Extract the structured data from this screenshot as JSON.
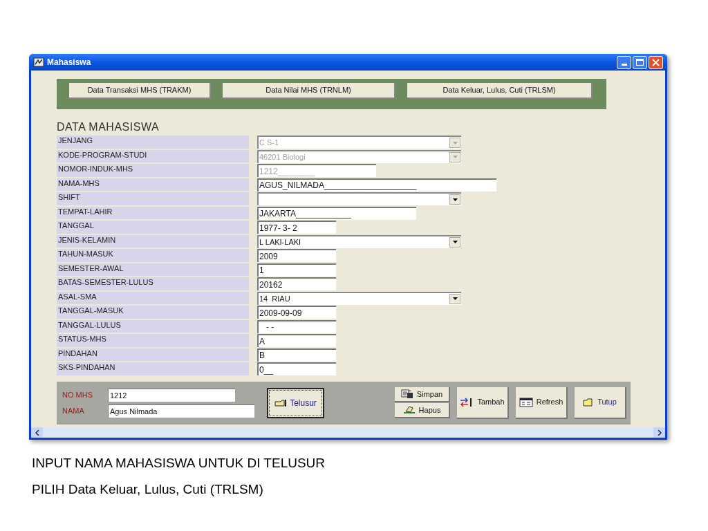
{
  "window": {
    "title": "Mahasiswa"
  },
  "nav_buttons": [
    "Data Transaksi MHS (TRAKM)",
    "Data Nilai MHS (TRNLM)",
    "Data Keluar, Lulus, Cuti (TRLSM)"
  ],
  "section_title": "DATA MAHASISWA",
  "fields": [
    {
      "label": "JENJANG",
      "kind": "combo",
      "value": "C S-1",
      "disabled": true
    },
    {
      "label": "KODE-PROGRAM-STUDI",
      "kind": "combo",
      "value": "46201 Biologi",
      "disabled": true
    },
    {
      "label": "NOMOR-INDUK-MHS",
      "kind": "text",
      "value": "1212________",
      "disabled": true
    },
    {
      "label": "NAMA-MHS",
      "kind": "text",
      "value": "AGUS_NILMADA____________________",
      "disabled": false
    },
    {
      "label": "SHIFT",
      "kind": "combo",
      "disabled": false
    },
    {
      "label": "TEMPAT-LAHIR",
      "kind": "text",
      "value": "JAKARTA____________",
      "disabled": false
    },
    {
      "label": "TANGGAL",
      "kind": "text",
      "value": "1977- 3- 2",
      "disabled": false
    },
    {
      "label": "JENIS-KELAMIN",
      "kind": "combo",
      "value": "L LAKI-LAKI",
      "disabled": false
    },
    {
      "label": "TAHUN-MASUK",
      "kind": "text",
      "value": "2009",
      "disabled": false
    },
    {
      "label": "SEMESTER-AWAL",
      "kind": "text",
      "value": "1",
      "disabled": false
    },
    {
      "label": "BATAS-SEMESTER-LULUS",
      "kind": "text",
      "value": "20162",
      "disabled": false
    },
    {
      "label": "ASAL-SMA",
      "kind": "combo",
      "value": "14  RIAU",
      "disabled": false
    },
    {
      "label": "TANGGAL-MASUK",
      "kind": "text",
      "value": "2009-09-09",
      "disabled": false
    },
    {
      "label": "TANGGAL-LULUS",
      "kind": "text",
      "value": "   - -",
      "disabled": false
    },
    {
      "label": "STATUS-MHS",
      "kind": "text",
      "value": "A",
      "disabled": false
    },
    {
      "label": "PINDAHAN",
      "kind": "text",
      "value": "B",
      "disabled": false
    },
    {
      "label": "SKS-PINDAHAN",
      "kind": "text",
      "value": "0__",
      "disabled": false
    }
  ],
  "search": {
    "fields": [
      {
        "label": "NO MHS",
        "value": "1212"
      },
      {
        "label": "NAMA",
        "value": "Agus Nilmada"
      }
    ],
    "button": "Telusur"
  },
  "actions": [
    {
      "label": "Simpan",
      "kind": "simpan"
    },
    {
      "label": "Hapus",
      "kind": "hapus"
    },
    {
      "label": "Tambah",
      "kind": "tambah"
    },
    {
      "label": "Refresh",
      "kind": "refresh"
    },
    {
      "label": "Tutup",
      "kind": "tutup"
    }
  ],
  "caption": [
    "INPUT NAMA MAHASISWA UNTUK DI TELUSUR",
    "PILIH Data Keluar, Lulus, Cuti (TRLSM)"
  ]
}
